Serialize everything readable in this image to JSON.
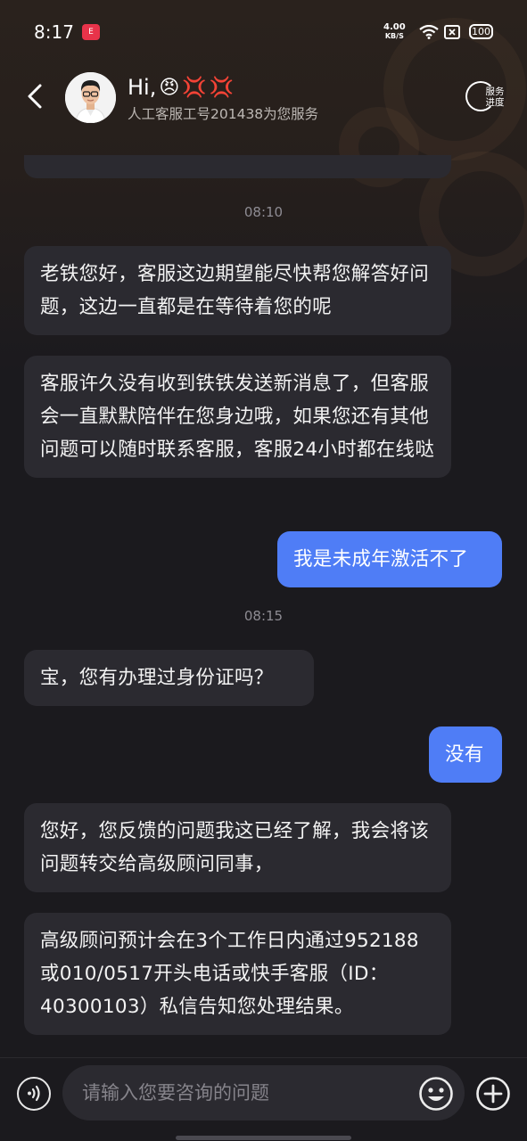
{
  "status_bar": {
    "time": "8:17",
    "app_badge": "E",
    "net_speed_value": "4.00",
    "net_speed_unit": "KB/S",
    "battery": "100"
  },
  "header": {
    "greeting": "Hi,",
    "emojis": [
      "😠",
      "💢",
      "💢"
    ],
    "subtitle": "人工客服工号201438为您服务",
    "progress_label": "服务\n进度"
  },
  "messages": [
    {
      "type": "timestamp",
      "text": "08:10"
    },
    {
      "type": "incoming",
      "text": "老铁您好，客服这边期望能尽快帮您解答好问题，这边一直都是在等待着您的呢"
    },
    {
      "type": "incoming",
      "text": "客服许久没有收到铁铁发送新消息了，但客服会一直默默陪伴在您身边哦，如果您还有其他问题可以随时联系客服，客服24小时都在线哒"
    },
    {
      "type": "outgoing",
      "text": "我是未成年激活不了"
    },
    {
      "type": "timestamp",
      "text": "08:15"
    },
    {
      "type": "incoming",
      "text": "宝，您有办理过身份证吗？"
    },
    {
      "type": "outgoing",
      "text": "没有"
    },
    {
      "type": "incoming",
      "text": "您好，您反馈的问题我这已经了解，我会将该问题转交给高级顾问同事，"
    },
    {
      "type": "incoming",
      "text": "高级顾问预计会在3个工作日内通过952188或010/0517开头电话或快手客服（ID：40300103）私信告知您处理结果。"
    }
  ],
  "input": {
    "placeholder": "请输入您要咨询的问题",
    "value": ""
  },
  "colors": {
    "outgoing_bubble": "#4f7df6",
    "incoming_bubble": "#2b2a30",
    "background": "#1b1a1e"
  },
  "icons": {
    "back": "chevron-left-icon",
    "voice": "voice-icon",
    "emoji": "emoji-icon",
    "plus": "plus-icon",
    "wifi": "wifi-icon",
    "progress": "service-progress-icon"
  }
}
